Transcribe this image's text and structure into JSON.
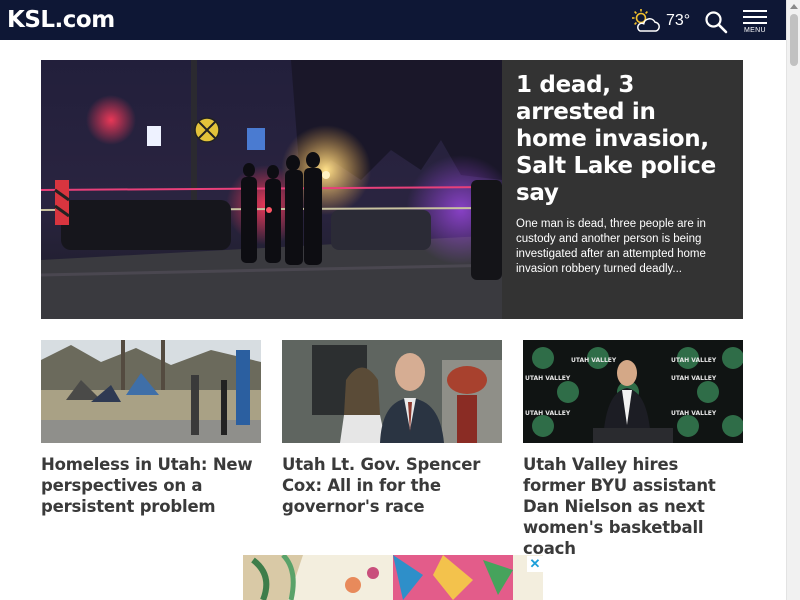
{
  "header": {
    "logo_text": "KSL",
    "logo_suffix": ".com",
    "weather": {
      "temperature": "73°",
      "icon": "partly-cloudy-sun-icon"
    },
    "search_icon": "search-icon",
    "menu_label": "MENU"
  },
  "hero": {
    "title": "1 dead, 3 arrested in home invasion, Salt Lake police say",
    "summary": "One man is dead, three people are in custody and another person is being investigated after an attempted home invasion robbery turned deadly..."
  },
  "cards": [
    {
      "title": "Homeless in Utah: New perspectives on a persistent problem"
    },
    {
      "title": "Utah Lt. Gov. Spencer Cox: All in for the governor's race"
    },
    {
      "title": "Utah Valley hires former BYU assistant Dan Nielson as next women's basketball coach"
    }
  ],
  "ad": {
    "close_label": "✕"
  },
  "colors": {
    "header_bg": "#0e1735",
    "hero_text_bg": "#333333",
    "card_title": "#3a3a3a",
    "ad_close": "#1d9fd9"
  }
}
